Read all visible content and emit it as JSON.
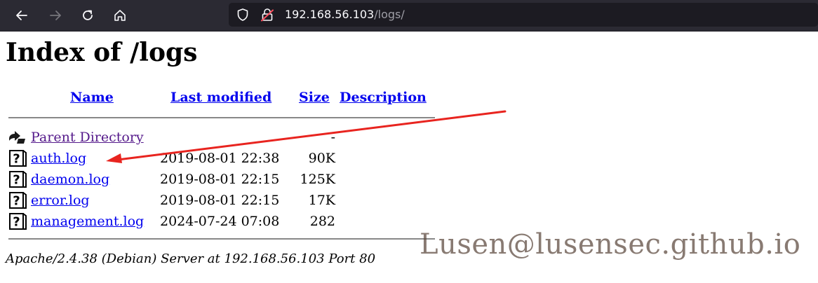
{
  "browser": {
    "url_host": "192.168.56.103",
    "url_path": "/logs/",
    "icons": [
      "back-arrow-icon",
      "forward-arrow-icon",
      "reload-icon",
      "home-icon",
      "shield-icon",
      "insecure-lock-icon"
    ]
  },
  "page": {
    "title": "Index of /logs",
    "columns": {
      "name": "Name",
      "last_modified": "Last modified",
      "size": "Size",
      "description": "Description"
    },
    "parent": {
      "name": "Parent Directory",
      "size": "-"
    },
    "rows": [
      {
        "name": "auth.log",
        "modified": "2019-08-01 22:38",
        "size": "90K"
      },
      {
        "name": "daemon.log",
        "modified": "2019-08-01 22:15",
        "size": "125K"
      },
      {
        "name": "error.log",
        "modified": "2019-08-01 22:15",
        "size": "17K"
      },
      {
        "name": "management.log",
        "modified": "2024-07-24 07:08",
        "size": "282"
      }
    ],
    "address": "Apache/2.4.38 (Debian) Server at 192.168.56.103 Port 80"
  },
  "overlay": {
    "watermark": "Lusen@lusensec.github.io",
    "arrow_color": "#e8241f"
  }
}
